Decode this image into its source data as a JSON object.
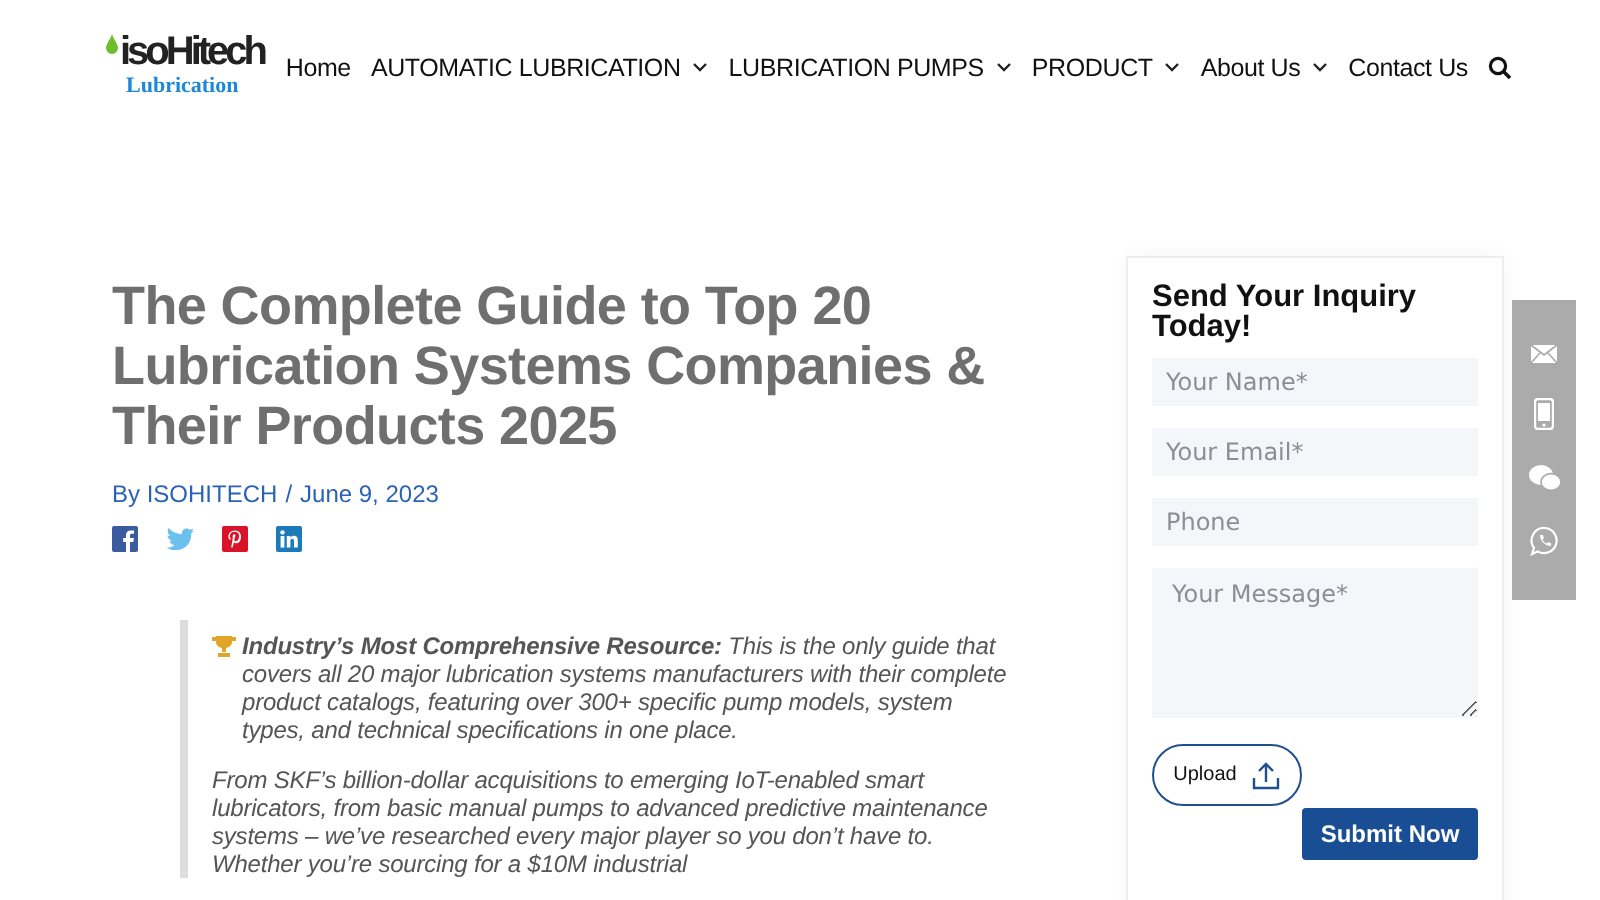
{
  "logo": {
    "main": "isoHitech",
    "sub": "Lubrication"
  },
  "nav": [
    {
      "label": "Home",
      "dropdown": false
    },
    {
      "label": "AUTOMATIC LUBRICATION",
      "dropdown": true
    },
    {
      "label": "LUBRICATION PUMPS",
      "dropdown": true
    },
    {
      "label": "PRODUCT",
      "dropdown": true
    },
    {
      "label": "About Us",
      "dropdown": true
    },
    {
      "label": "Contact Us",
      "dropdown": false
    }
  ],
  "article": {
    "title": "The Complete Guide to Top 20 Lubrication Systems Companies & Their Products 2025",
    "author": "By ISOHITECH",
    "separator": "/",
    "date": "June 9, 2023",
    "share": [
      {
        "kind": "facebook"
      },
      {
        "kind": "twitter"
      },
      {
        "kind": "pinterest"
      },
      {
        "kind": "linkedin"
      }
    ],
    "quote": [
      "**Industry’s Most Comprehensive Resource:** This is the only guide that covers all 20 major lubrication systems manufacturers with their complete product catalogs, featuring over 300+ specific pump models, system types, and technical specifications in one place.",
      "From SKF’s billion-dollar acquisitions to emerging IoT-enabled smart lubricators, from basic manual pumps to advanced predictive maintenance systems – we’ve researched every major player so you don’t have to. Whether you’re sourcing for a $10M industrial"
    ]
  },
  "form": {
    "title": "Send Your Inquiry Today!",
    "fields": [
      {
        "kind": "input",
        "placeholder": "Your Name*"
      },
      {
        "kind": "input",
        "placeholder": "Your Email*"
      },
      {
        "kind": "input",
        "placeholder": "Phone"
      },
      {
        "kind": "textarea",
        "placeholder": "Your Message*"
      }
    ],
    "upload": "Upload",
    "submit": "Submit Now"
  },
  "contact_bar": [
    {
      "kind": "mail"
    },
    {
      "kind": "phone"
    },
    {
      "kind": "wechat"
    },
    {
      "kind": "whatsapp"
    }
  ]
}
